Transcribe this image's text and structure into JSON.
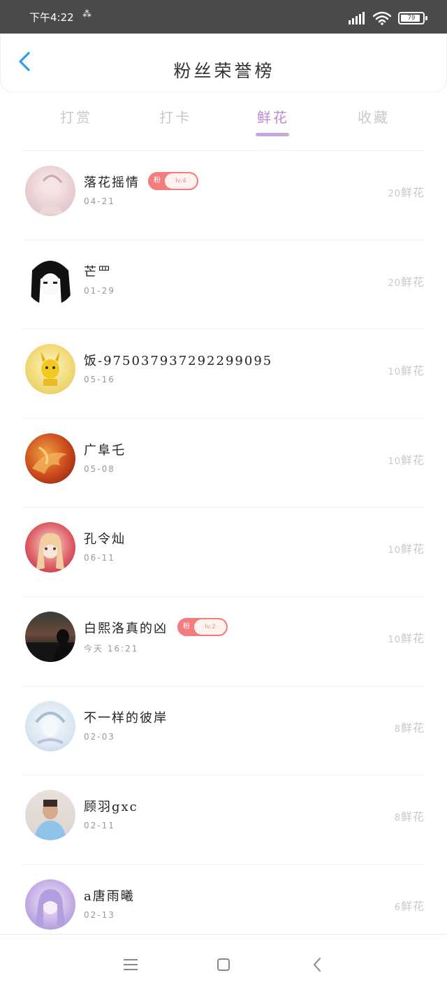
{
  "status_bar": {
    "time": "下午4:22",
    "notification_glyph": "⁂",
    "battery_level": "79",
    "battery_fraction": 0.79,
    "icons": [
      "signal-icon",
      "wifi-icon",
      "battery-icon"
    ]
  },
  "header": {
    "title": "粉丝荣誉榜",
    "back_icon": "chevron-left-icon",
    "accent_color": "#2e9df0"
  },
  "tabs": [
    {
      "label": "打赏",
      "active": false
    },
    {
      "label": "打卡",
      "active": false
    },
    {
      "label": "鲜花",
      "active": true
    },
    {
      "label": "收藏",
      "active": false
    }
  ],
  "colors": {
    "tab_active": "#b889d6",
    "badge": "#f27d7d",
    "count_text": "#c9c9c9"
  },
  "fans": [
    {
      "name": "落花摇情",
      "date": "04-21",
      "count": "20",
      "unit": "鲜花",
      "badge": {
        "prefix": "粉",
        "level": "lv.4"
      }
    },
    {
      "name": "芒罒",
      "date": "01-29",
      "count": "20",
      "unit": "鲜花"
    },
    {
      "name": "饭-975037937292299095",
      "date": "05-16",
      "count": "10",
      "unit": "鲜花"
    },
    {
      "name": "广阜乇",
      "date": "05-08",
      "count": "10",
      "unit": "鲜花"
    },
    {
      "name": "孔令灿",
      "date": "06-11",
      "count": "10",
      "unit": "鲜花"
    },
    {
      "name": "白熙洛真的凶",
      "date": "今天 16:21",
      "count": "10",
      "unit": "鲜花",
      "badge": {
        "prefix": "粉",
        "level": "lv.2"
      }
    },
    {
      "name": "不一样的彼岸",
      "date": "02-03",
      "count": "8",
      "unit": "鲜花"
    },
    {
      "name": "顾羽gxc",
      "date": "02-11",
      "count": "8",
      "unit": "鲜花"
    },
    {
      "name": "a唐雨曦",
      "date": "02-13",
      "count": "6",
      "unit": "鲜花"
    }
  ],
  "nav_bar": {
    "icons": [
      "menu-icon",
      "home-square-icon",
      "back-chevron-icon"
    ]
  }
}
